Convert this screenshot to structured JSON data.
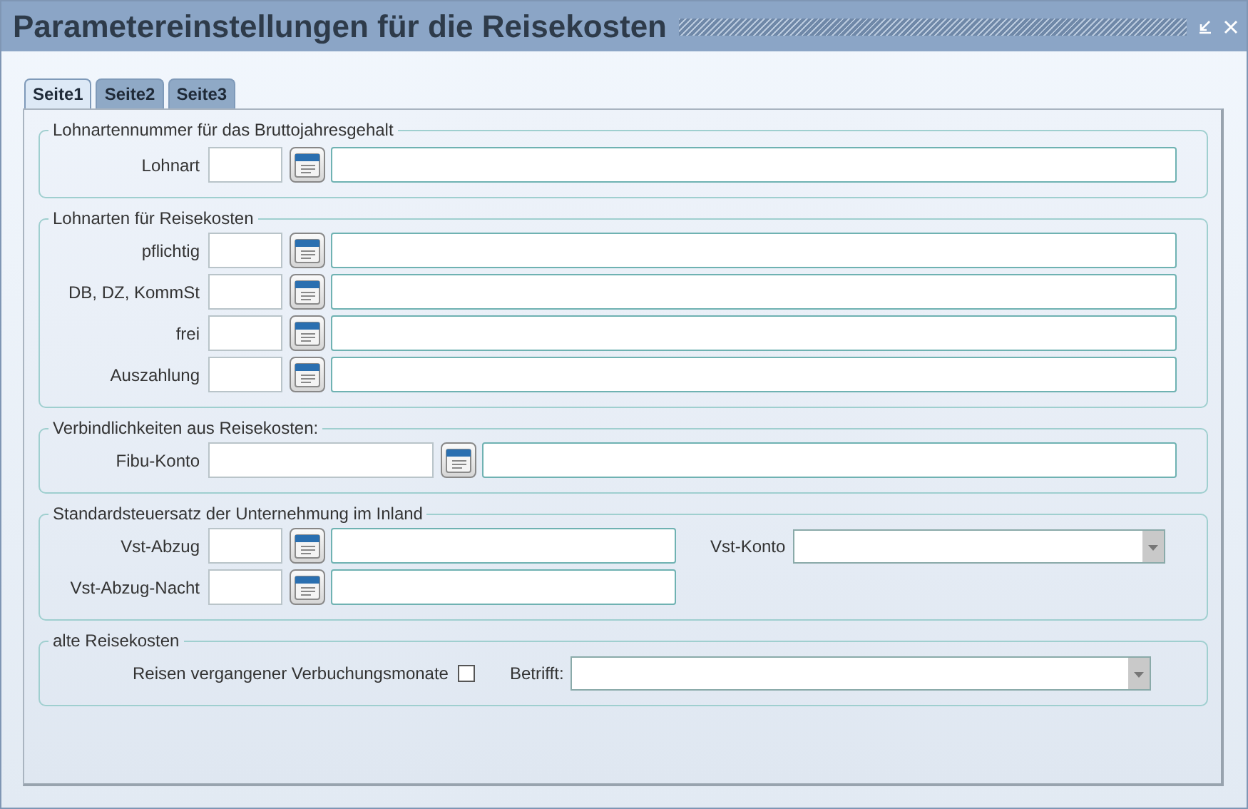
{
  "window": {
    "title": "Parametereinstellungen für die Reisekosten"
  },
  "tabs": [
    {
      "label": "Seite1",
      "selected": true
    },
    {
      "label": "Seite2",
      "selected": false
    },
    {
      "label": "Seite3",
      "selected": false
    }
  ],
  "sections": [
    {
      "legend": "Lohnartennummer für das Bruttojahresgehalt",
      "rows": [
        [
          {
            "kind": "lookup",
            "label": "Lohnart"
          }
        ]
      ]
    },
    {
      "legend": "Lohnarten für Reisekosten",
      "rows": [
        [
          {
            "kind": "lookup",
            "label": "pflichtig"
          }
        ],
        [
          {
            "kind": "lookup",
            "label": "DB, DZ, KommSt"
          }
        ],
        [
          {
            "kind": "lookup",
            "label": "frei"
          }
        ],
        [
          {
            "kind": "lookup",
            "label": "Auszahlung"
          }
        ]
      ]
    },
    {
      "legend": "Verbindlichkeiten aus Reisekosten:",
      "rows": [
        [
          {
            "kind": "lookup_wide",
            "label": "Fibu-Konto"
          }
        ]
      ]
    },
    {
      "legend": "Standardsteuersatz der Unternehmung im Inland",
      "rows": [
        [
          {
            "kind": "lookup_short",
            "label": "Vst-Abzug"
          },
          {
            "kind": "select",
            "label": "Vst-Konto"
          }
        ],
        [
          {
            "kind": "lookup_short",
            "label": "Vst-Abzug-Nacht"
          }
        ]
      ]
    },
    {
      "legend": "alte Reisekosten",
      "rows": [
        [
          {
            "kind": "checkbox",
            "label": "Reisen vergangener Verbuchungsmonate",
            "checked": false
          },
          {
            "kind": "select_inline",
            "label": "Betrifft:"
          }
        ]
      ]
    }
  ]
}
